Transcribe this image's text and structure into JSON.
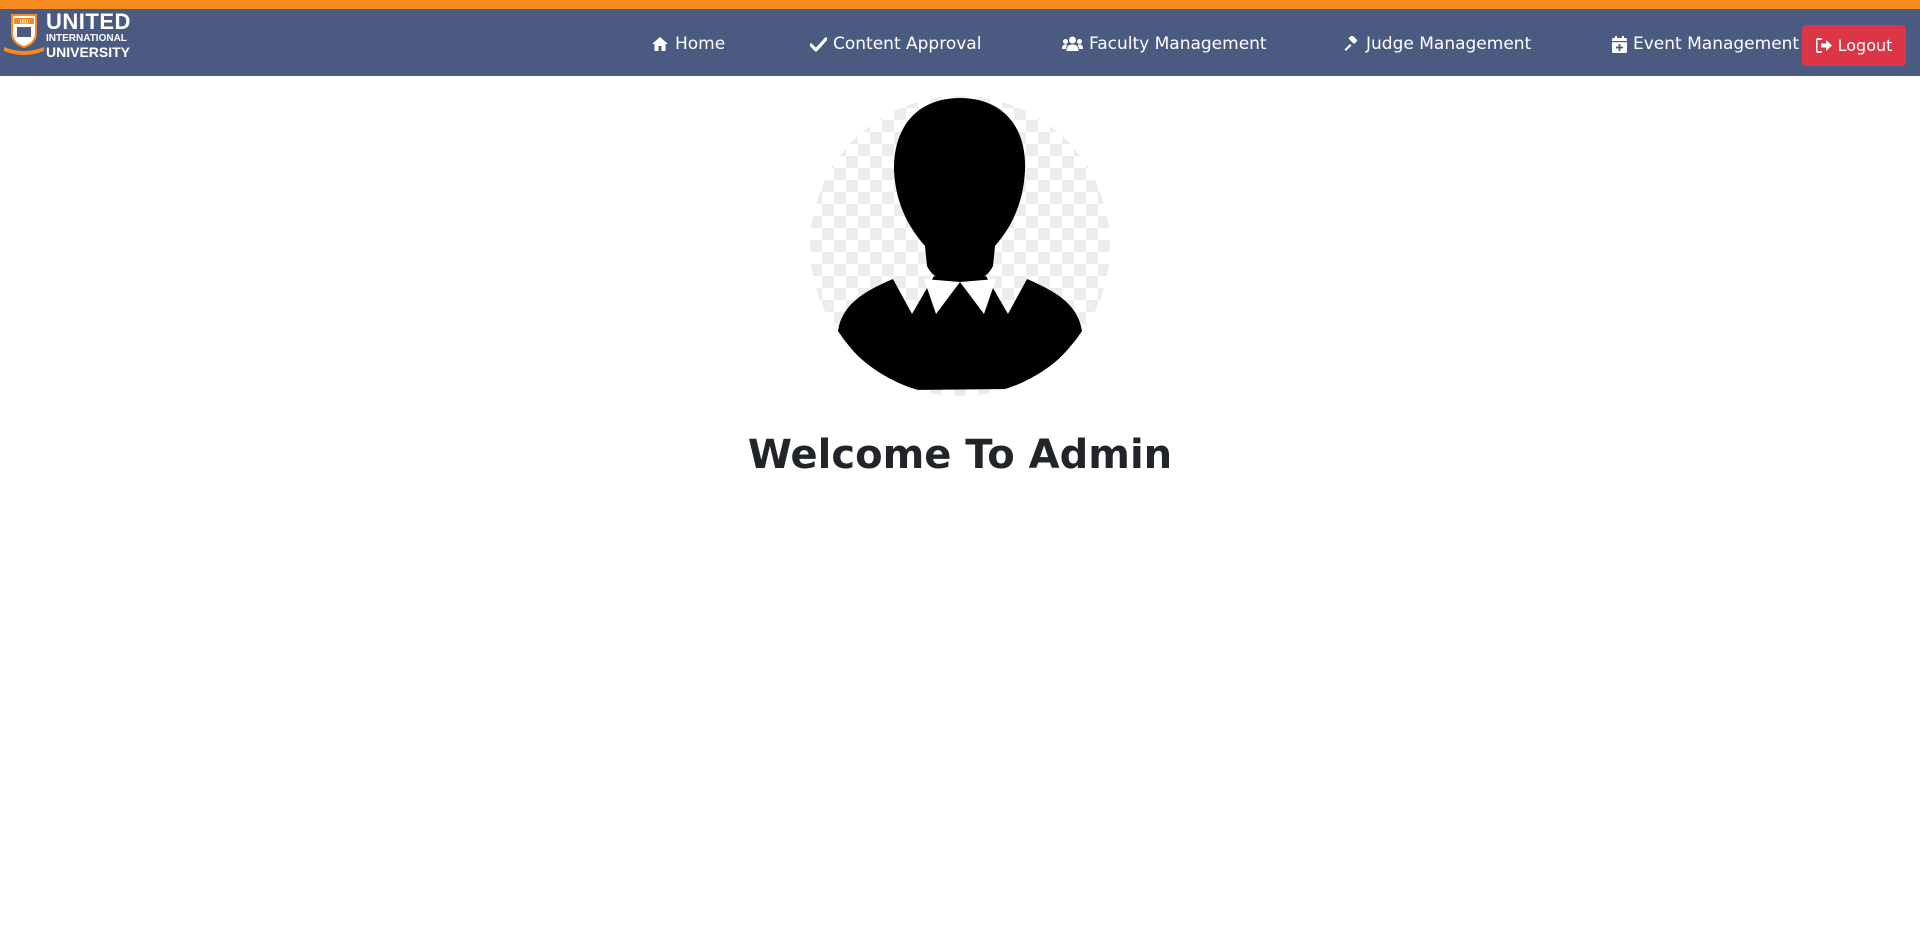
{
  "brand": {
    "line1": "UNITED",
    "line2": "INTERNATIONAL",
    "line3": "UNIVERSITY",
    "crest_text": "UIU",
    "accent_color": "#f68b1f",
    "navbar_color": "#4b5a80"
  },
  "nav": {
    "items": [
      {
        "label": "Home",
        "icon": "home-icon"
      },
      {
        "label": "Content Approval",
        "icon": "check-icon"
      },
      {
        "label": "Faculty Management",
        "icon": "users-icon"
      },
      {
        "label": "Judge Management",
        "icon": "gavel-icon"
      },
      {
        "label": "Event Management",
        "icon": "calendar-plus-icon"
      }
    ],
    "logout": {
      "label": "Logout",
      "icon": "sign-out-icon",
      "color": "#dc3545"
    }
  },
  "main": {
    "avatar_icon": "user-silhouette-icon",
    "welcome": "Welcome To Admin"
  }
}
